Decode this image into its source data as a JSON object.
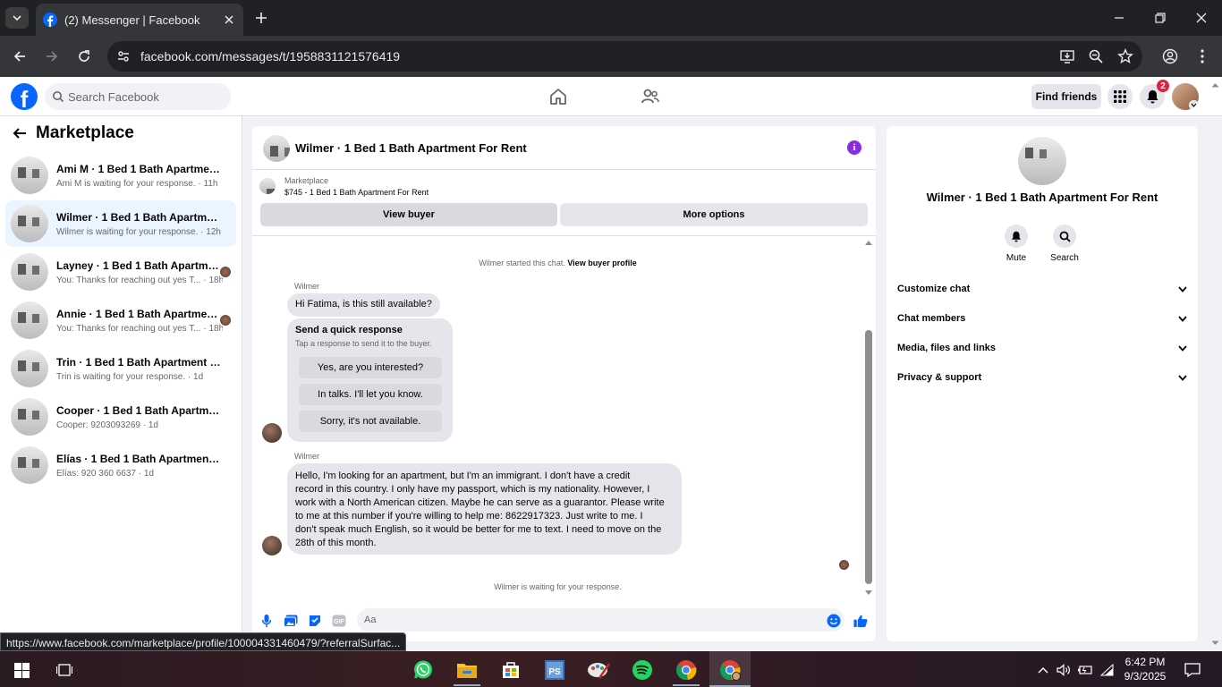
{
  "browser": {
    "tab_title": "(2) Messenger | Facebook",
    "url": "facebook.com/messages/t/1958831121576419",
    "status_link": "https://www.facebook.com/marketplace/profile/100004331460479/?referralSurfac..."
  },
  "fb_header": {
    "search_placeholder": "Search Facebook",
    "find_friends_label": "Find friends",
    "notifications_count": "2"
  },
  "sidebar": {
    "title": "Marketplace",
    "conversations": [
      {
        "name": "Ami M · 1 Bed 1 Bath Apartment F...",
        "preview": "Ami M is waiting for your response. · 11h",
        "active": false
      },
      {
        "name": "Wilmer · 1 Bed 1 Bath Apartment F...",
        "preview": "Wilmer is waiting for your response. · 12h",
        "active": true
      },
      {
        "name": "Layney · 1 Bed 1 Bath Apartment...",
        "preview": "You: Thanks for reaching out yes T... · 18h",
        "active": false
      },
      {
        "name": "Annie · 1 Bed 1 Bath Apartment ...",
        "preview": "You: Thanks for reaching out yes T... · 18h",
        "active": false
      },
      {
        "name": "Trin · 1 Bed 1 Bath Apartment For R...",
        "preview": "Trin is waiting for your response. · 1d",
        "active": false
      },
      {
        "name": "Cooper · 1 Bed 1 Bath Apartment F...",
        "preview": "Cooper: 9203093269 · 1d",
        "active": false
      },
      {
        "name": "Elías · 1 Bed 1 Bath Apartment For ...",
        "preview": "Elías: 920 360 6637 · 1d",
        "active": false
      }
    ]
  },
  "chat": {
    "title": "Wilmer · 1 Bed 1 Bath Apartment For Rent",
    "marketplace_label": "Marketplace",
    "listing": "$745 - 1 Bed 1 Bath Apartment For Rent",
    "view_buyer_label": "View buyer",
    "more_options_label": "More options",
    "started_text": "Wilmer started this chat.",
    "view_buyer_profile": "View buyer profile",
    "sender_name": "Wilmer",
    "message1": "Hi Fatima, is this still available?",
    "quick_title": "Send a quick response",
    "quick_subtitle": "Tap a response to send it to the buyer.",
    "quick_responses": [
      "Yes, are you interested?",
      "In talks. I'll let you know.",
      "Sorry, it's not available."
    ],
    "message2_lines": [
      "Hello, I'm looking for an apartment, but I'm an immigrant. I don't have a credit",
      "record in this country. I only have my passport, which is my nationality. However, I",
      "work with a North American citizen. Maybe he can serve as a guarantor. Please write",
      "to me at this number if you're willing to help me: 8622917323. Just write to me. I",
      "don't speak much English, so it would be better for me to text. I need to move on the",
      "28th of this month."
    ],
    "waiting_text": "Wilmer is waiting for your response.",
    "composer_placeholder": "Aa"
  },
  "details": {
    "name": "Wilmer · 1 Bed 1 Bath Apartment For Rent",
    "mute_label": "Mute",
    "search_label": "Search",
    "sections": [
      "Customize chat",
      "Chat members",
      "Media, files and links",
      "Privacy & support"
    ]
  },
  "taskbar": {
    "time": "6:42 PM",
    "date": "9/3/2025"
  },
  "colors": {
    "fb_blue": "#0866ff",
    "active_conversation": "#ebf5ff",
    "info_purple": "#8a2be2",
    "badge_red": "#e41e3f"
  }
}
